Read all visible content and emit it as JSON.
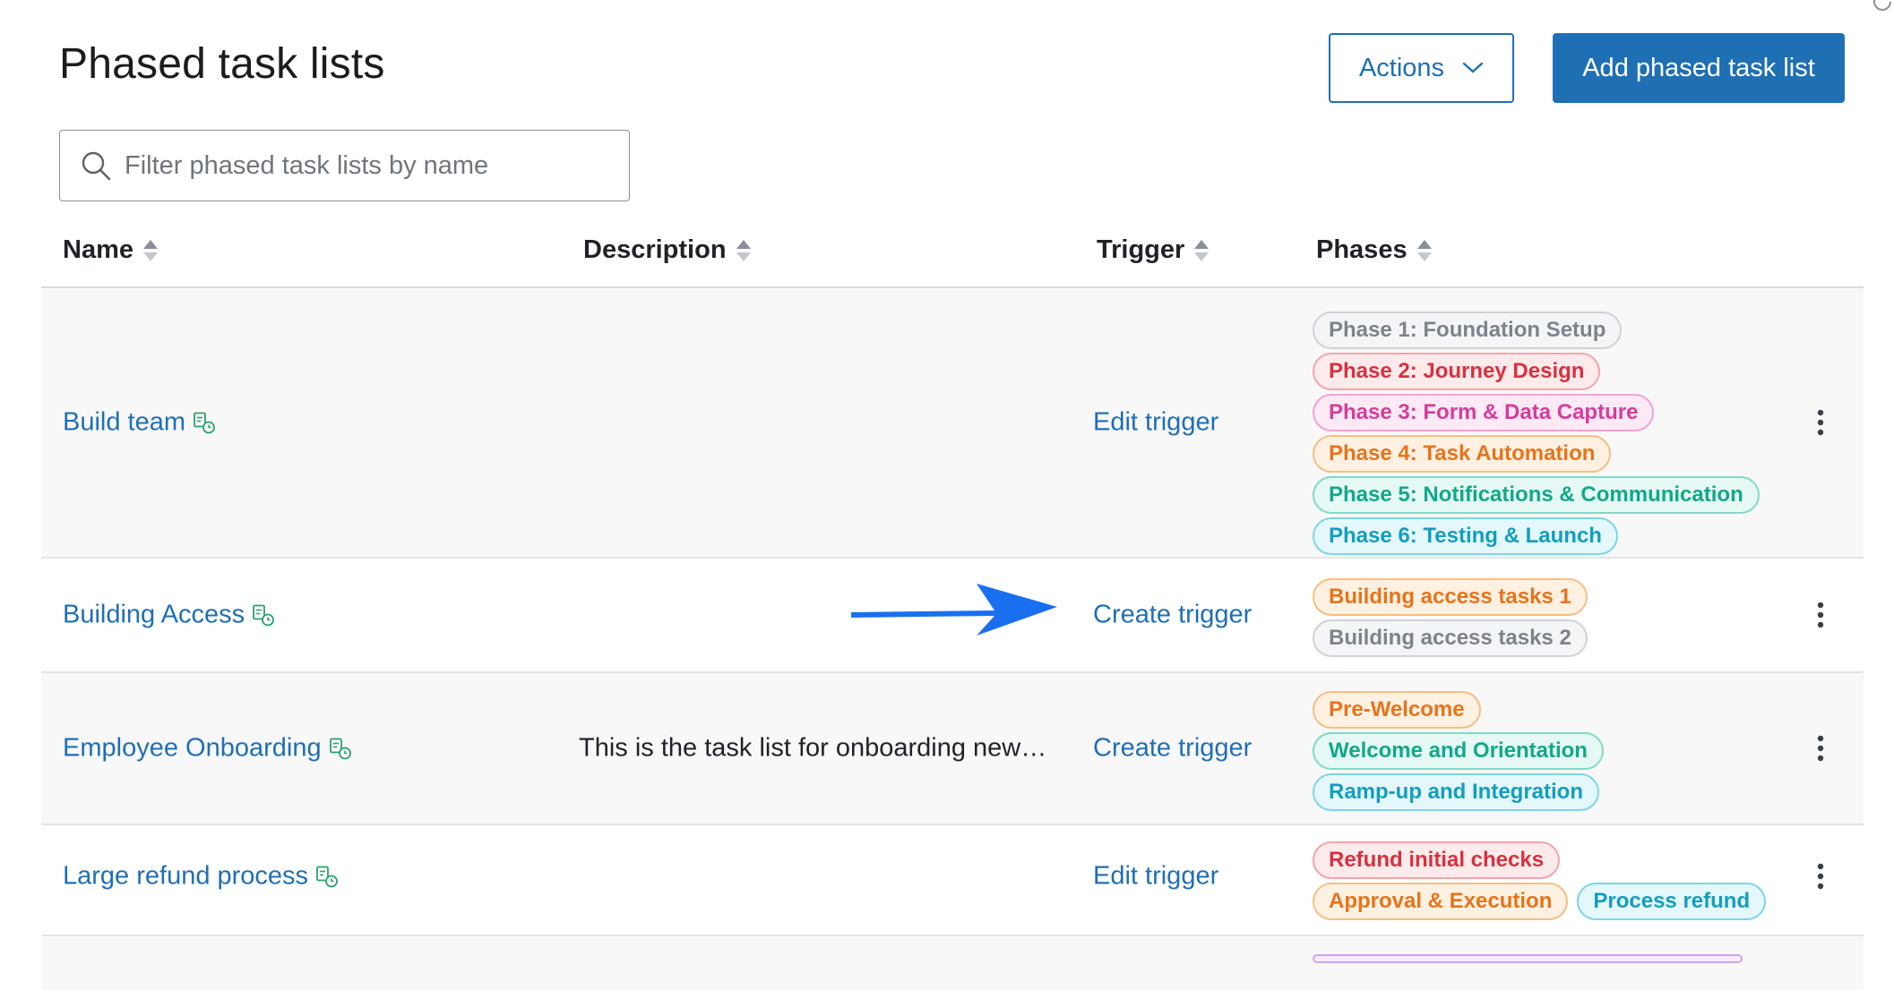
{
  "page": {
    "title": "Phased task lists",
    "actions_label": "Actions",
    "add_label": "Add phased task list"
  },
  "search": {
    "placeholder": "Filter phased task lists by name",
    "value": ""
  },
  "table": {
    "columns": [
      "Name",
      "Description",
      "Trigger",
      "Phases"
    ],
    "rows": [
      {
        "name": "Build team",
        "description": "",
        "trigger": "Edit trigger",
        "phases": [
          [
            {
              "label": "Phase 1: Foundation Setup",
              "color": "grey"
            }
          ],
          [
            {
              "label": "Phase 2: Journey Design",
              "color": "red"
            }
          ],
          [
            {
              "label": "Phase 3: Form & Data Capture",
              "color": "pink"
            }
          ],
          [
            {
              "label": "Phase 4: Task Automation",
              "color": "orange"
            }
          ],
          [
            {
              "label": "Phase 5: Notifications & Communication",
              "color": "teal"
            }
          ],
          [
            {
              "label": "Phase 6: Testing & Launch",
              "color": "cyan"
            }
          ]
        ]
      },
      {
        "name": "Building Access",
        "description": "",
        "trigger": "Create trigger",
        "phases": [
          [
            {
              "label": "Building access tasks 1",
              "color": "orange"
            }
          ],
          [
            {
              "label": "Building access tasks 2",
              "color": "grey"
            }
          ]
        ]
      },
      {
        "name": "Employee Onboarding",
        "description": "This is the task list for onboarding new…",
        "trigger": "Create trigger",
        "phases": [
          [
            {
              "label": "Pre-Welcome",
              "color": "orange"
            }
          ],
          [
            {
              "label": "Welcome and Orientation",
              "color": "teal"
            }
          ],
          [
            {
              "label": "Ramp-up and Integration",
              "color": "cyan"
            }
          ]
        ]
      },
      {
        "name": "Large refund process",
        "description": "",
        "trigger": "Edit trigger",
        "phases": [
          [
            {
              "label": "Refund initial checks",
              "color": "red"
            }
          ],
          [
            {
              "label": "Approval & Execution",
              "color": "orange"
            },
            {
              "label": "Process refund",
              "color": "cyan"
            }
          ]
        ]
      },
      {
        "name": "",
        "description": "",
        "trigger": "",
        "phases": [
          [
            {
              "label": "",
              "color": "purple"
            }
          ]
        ]
      }
    ]
  },
  "colors": {
    "accent": "#1f6fb5",
    "arrow": "#1a6ff0"
  },
  "icons": {
    "search": "search-icon",
    "sort": "sort-icon",
    "list_trigger": "list-trigger-icon",
    "more": "kebab-menu-icon",
    "chevron": "chevron-down-icon"
  }
}
